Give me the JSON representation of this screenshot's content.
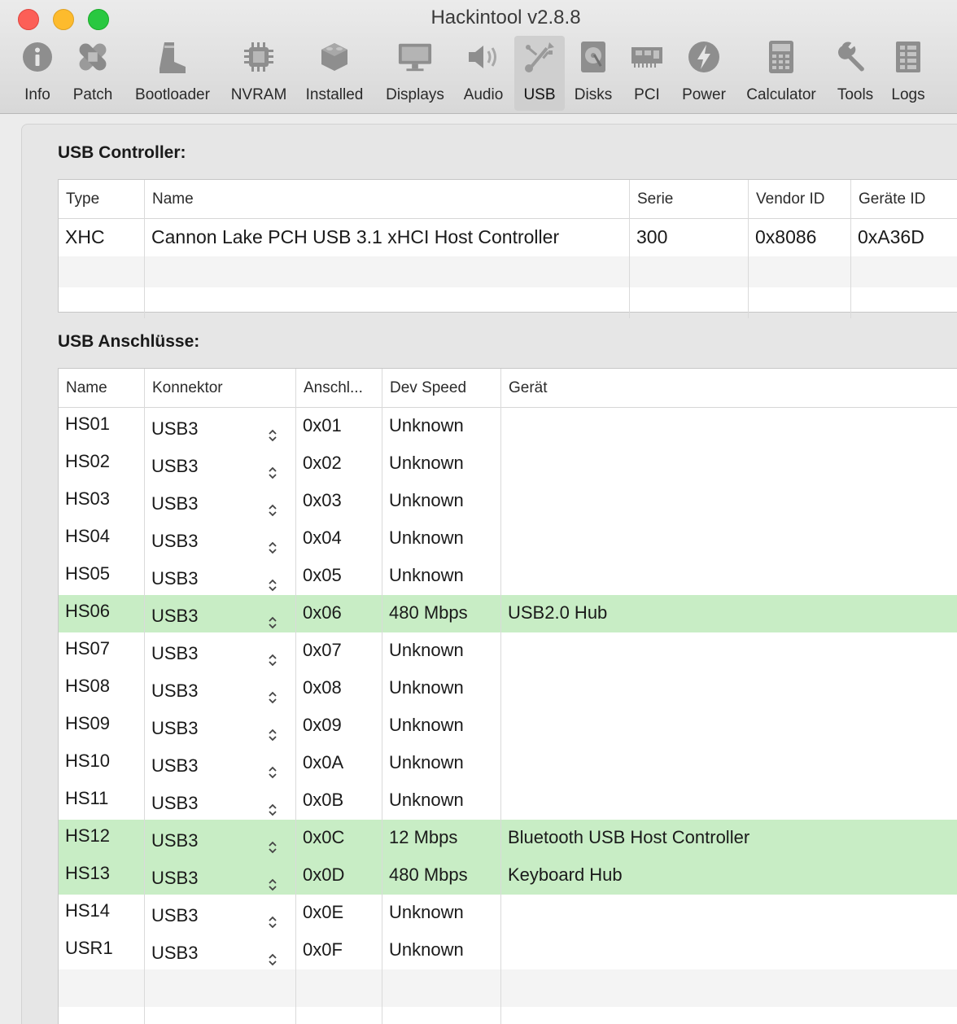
{
  "window": {
    "title": "Hackintool v2.8.8"
  },
  "toolbar": [
    {
      "label": "Info",
      "icon": "info-icon"
    },
    {
      "label": "Patch",
      "icon": "bandage-icon"
    },
    {
      "label": "Bootloader",
      "icon": "boot-icon"
    },
    {
      "label": "NVRAM",
      "icon": "chip-icon"
    },
    {
      "label": "Installed",
      "icon": "lego-brick-icon"
    },
    {
      "label": "Displays",
      "icon": "monitor-icon"
    },
    {
      "label": "Audio",
      "icon": "speaker-icon"
    },
    {
      "label": "USB",
      "icon": "usb-icon",
      "active": true
    },
    {
      "label": "Disks",
      "icon": "disk-icon"
    },
    {
      "label": "PCI",
      "icon": "pci-card-icon"
    },
    {
      "label": "Power",
      "icon": "power-bolt-icon"
    },
    {
      "label": "Calculator",
      "icon": "calculator-icon"
    },
    {
      "label": "Tools",
      "icon": "wrench-icon"
    },
    {
      "label": "Logs",
      "icon": "logs-icon"
    }
  ],
  "controller_section": {
    "title": "USB Controller:",
    "columns": [
      "Type",
      "Name",
      "Serie",
      "Vendor ID",
      "Geräte ID"
    ],
    "rows": [
      {
        "type": "XHC",
        "name": "Cannon Lake PCH USB 3.1 xHCI Host Controller",
        "serie": "300",
        "vendor_id": "0x8086",
        "device_id": "0xA36D"
      }
    ]
  },
  "ports_section": {
    "title": "USB Anschlüsse:",
    "columns": [
      "Name",
      "Konnektor",
      "Anschl...",
      "Dev Speed",
      "Gerät"
    ],
    "rows": [
      {
        "name": "HS01",
        "connector": "USB3",
        "port": "0x01",
        "speed": "Unknown",
        "device": "",
        "highlighted": false
      },
      {
        "name": "HS02",
        "connector": "USB3",
        "port": "0x02",
        "speed": "Unknown",
        "device": "",
        "highlighted": false
      },
      {
        "name": "HS03",
        "connector": "USB3",
        "port": "0x03",
        "speed": "Unknown",
        "device": "",
        "highlighted": false
      },
      {
        "name": "HS04",
        "connector": "USB3",
        "port": "0x04",
        "speed": "Unknown",
        "device": "",
        "highlighted": false
      },
      {
        "name": "HS05",
        "connector": "USB3",
        "port": "0x05",
        "speed": "Unknown",
        "device": "",
        "highlighted": false
      },
      {
        "name": "HS06",
        "connector": "USB3",
        "port": "0x06",
        "speed": "480 Mbps",
        "device": "USB2.0 Hub",
        "highlighted": true
      },
      {
        "name": "HS07",
        "connector": "USB3",
        "port": "0x07",
        "speed": "Unknown",
        "device": "",
        "highlighted": false
      },
      {
        "name": "HS08",
        "connector": "USB3",
        "port": "0x08",
        "speed": "Unknown",
        "device": "",
        "highlighted": false
      },
      {
        "name": "HS09",
        "connector": "USB3",
        "port": "0x09",
        "speed": "Unknown",
        "device": "",
        "highlighted": false
      },
      {
        "name": "HS10",
        "connector": "USB3",
        "port": "0x0A",
        "speed": "Unknown",
        "device": "",
        "highlighted": false
      },
      {
        "name": "HS11",
        "connector": "USB3",
        "port": "0x0B",
        "speed": "Unknown",
        "device": "",
        "highlighted": false
      },
      {
        "name": "HS12",
        "connector": "USB3",
        "port": "0x0C",
        "speed": "12 Mbps",
        "device": "Bluetooth USB Host Controller",
        "highlighted": true
      },
      {
        "name": "HS13",
        "connector": "USB3",
        "port": "0x0D",
        "speed": "480 Mbps",
        "device": "Keyboard Hub",
        "highlighted": true
      },
      {
        "name": "HS14",
        "connector": "USB3",
        "port": "0x0E",
        "speed": "Unknown",
        "device": "",
        "highlighted": false
      },
      {
        "name": "USR1",
        "connector": "USB3",
        "port": "0x0F",
        "speed": "Unknown",
        "device": "",
        "highlighted": false
      }
    ]
  },
  "colors": {
    "highlight_row": "#c8edc5",
    "active_tab": "#cfcfcf"
  }
}
